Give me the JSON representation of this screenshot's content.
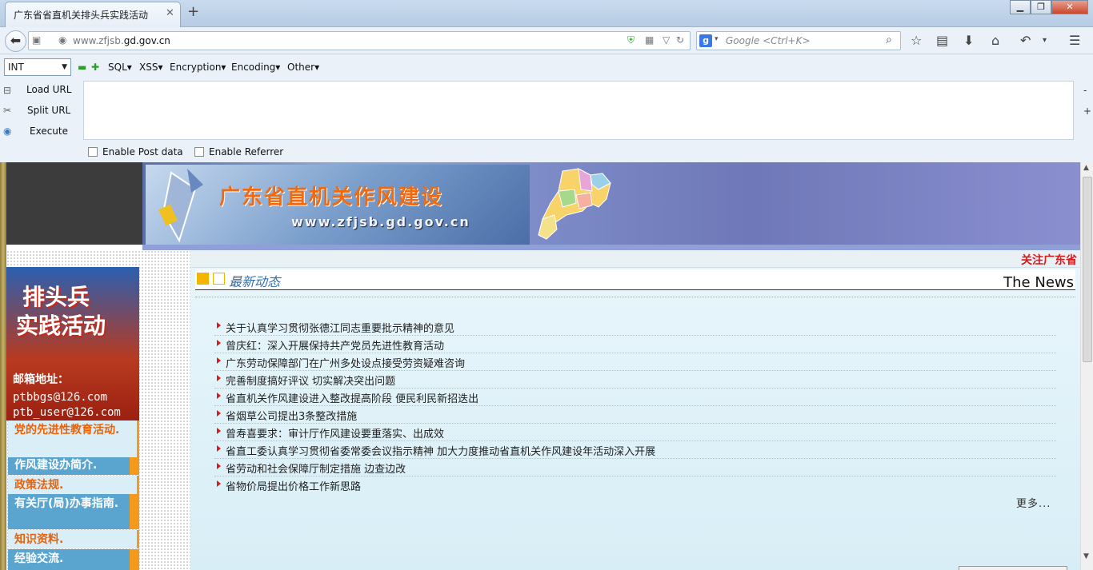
{
  "browser": {
    "tab_title": "广东省省直机关排头兵实践活动",
    "tab_close": "✕",
    "new_tab": "+",
    "url_prefix": "www.zfjsb.",
    "url_domain": "gd.gov.cn",
    "search_placeholder": "Google <Ctrl+K>",
    "search_engine_letter": "g"
  },
  "hackbar": {
    "select_value": "INT",
    "menus": [
      "SQL▾",
      "XSS▾",
      "Encryption▾",
      "Encoding▾",
      "Other▾"
    ],
    "load_url": "Load URL",
    "split_url": "Split URL",
    "execute": "Execute",
    "enable_post": "Enable Post data",
    "enable_referrer": "Enable Referrer",
    "minus": "-",
    "plus": "+"
  },
  "banner": {
    "title": "广东省直机关作风建设",
    "url": "www.zfjsb.gd.gov.cn"
  },
  "sidebar": {
    "promo_line1": "排头兵",
    "promo_line2": "实践活动",
    "mail_label": "邮箱地址：",
    "mail1": "ptbbgs@126.com",
    "mail2": "ptb_user@126.com",
    "links": [
      "党的先进性教育活动.",
      "作风建设办简介.",
      "政策法规.",
      "有关厅(局)办事指南.",
      "知识资料.",
      "经验交流."
    ]
  },
  "main": {
    "ticker": "关注广东省",
    "section_title": "最新动态",
    "section_en": "The News",
    "news": [
      "关于认真学习贯彻张德江同志重要批示精神的意见",
      "曾庆红：深入开展保持共产党员先进性教育活动",
      "广东劳动保障部门在广州多处设点接受劳资疑难咨询",
      "完善制度搞好评议  切实解决突出问题",
      "省直机关作风建设进入整改提高阶段  便民利民新招迭出",
      "省烟草公司提出3条整改措施",
      "曾寿喜要求：审计厅作风建设要重落实、出成效",
      "省直工委认真学习贯彻省委常委会议指示精神  加大力度推动省直机关作风建设年活动深入开展",
      "省劳动和社会保障厅制定措施  边查边改",
      "省物价局提出价格工作新思路"
    ],
    "more": "更多..."
  }
}
